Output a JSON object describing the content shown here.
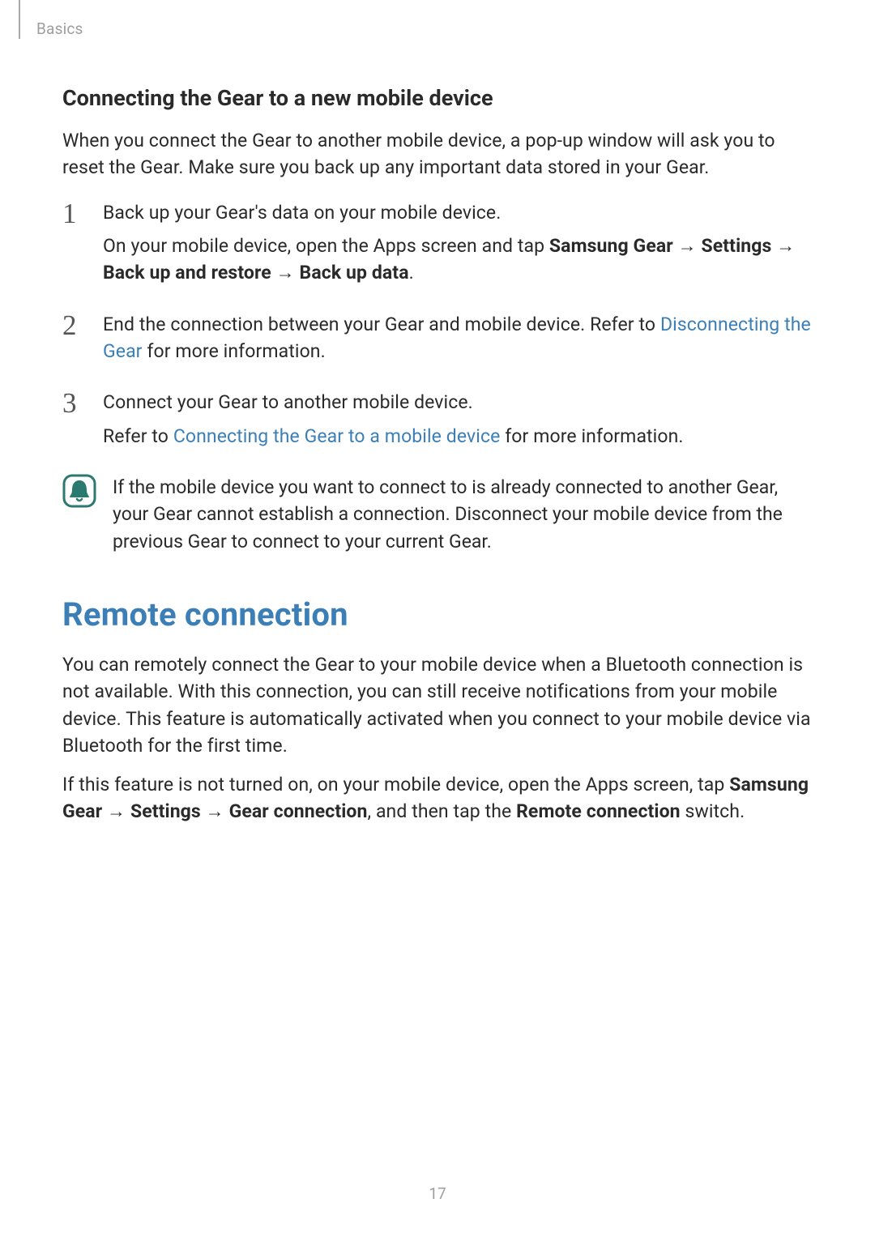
{
  "breadcrumb": "Basics",
  "subheading": "Connecting the Gear to a new mobile device",
  "intro": "When you connect the Gear to another mobile device, a pop-up window will ask you to reset the Gear. Make sure you back up any important data stored in your Gear.",
  "steps": [
    {
      "num": "1",
      "line1": "Back up your Gear's data on your mobile device.",
      "line2_pre": "On your mobile device, open the Apps screen and tap ",
      "bold1": "Samsung Gear",
      "arrow": " → ",
      "bold2": "Settings",
      "arrow2": " → ",
      "bold3": "Back up and restore",
      "arrow3": " → ",
      "bold4": "Back up data",
      "line2_post": "."
    },
    {
      "num": "2",
      "line1_pre": "End the connection between your Gear and mobile device. Refer to ",
      "link": "Disconnecting the Gear",
      "line1_post": " for more information."
    },
    {
      "num": "3",
      "line1": "Connect your Gear to another mobile device.",
      "line2_pre": "Refer to ",
      "link": "Connecting the Gear to a mobile device",
      "line2_post": " for more information."
    }
  ],
  "note": "If the mobile device you want to connect to is already connected to another Gear, your Gear cannot establish a connection. Disconnect your mobile device from the previous Gear to connect to your current Gear.",
  "h1": "Remote connection",
  "remote_p1": "You can remotely connect the Gear to your mobile device when a Bluetooth connection is not available. With this connection, you can still receive notifications from your mobile device. This feature is automatically activated when you connect to your mobile device via Bluetooth for the first time.",
  "remote_p2_pre": "If this feature is not turned on, on your mobile device, open the Apps screen, tap ",
  "remote_bold1": "Samsung Gear",
  "remote_arrow": " → ",
  "remote_bold2": "Settings",
  "remote_arrow2": " → ",
  "remote_bold3": "Gear connection",
  "remote_mid": ", and then tap the ",
  "remote_bold4": "Remote connection",
  "remote_p2_post": " switch.",
  "page_number": "17"
}
